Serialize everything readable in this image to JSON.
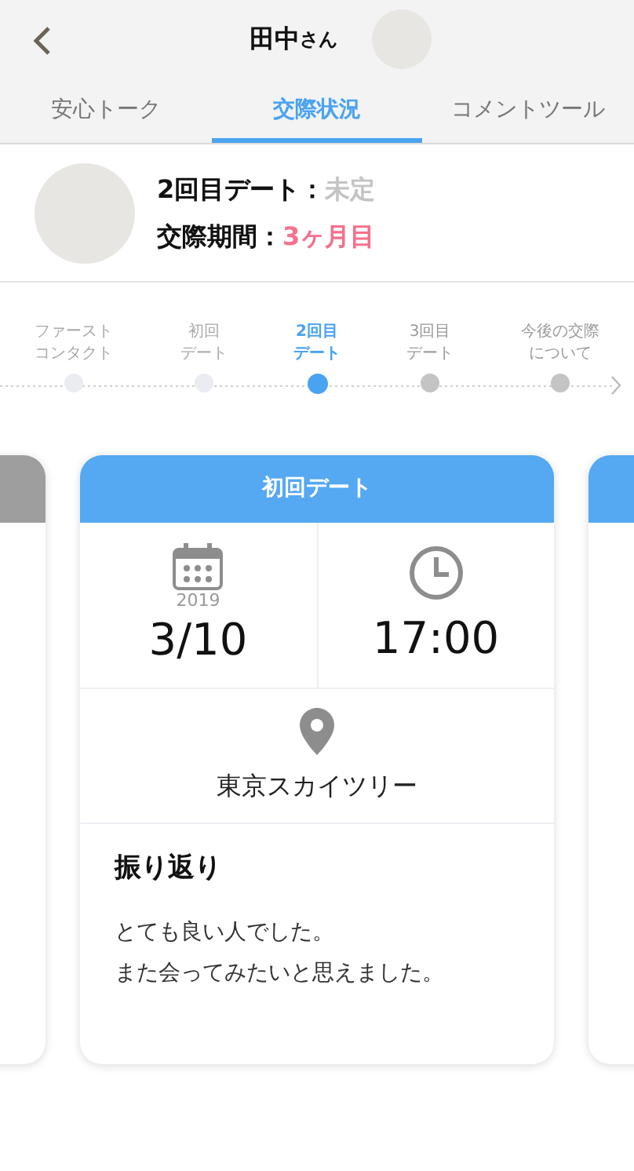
{
  "header": {
    "name": "田中",
    "honorific": "さん"
  },
  "tabs": [
    {
      "label": "安心トーク",
      "selected": false
    },
    {
      "label": "交際状況",
      "selected": true
    },
    {
      "label": "コメントツール",
      "selected": false
    }
  ],
  "profile": {
    "rows": [
      {
        "label": "2回目デート：",
        "value": "未定",
        "kind": "muted"
      },
      {
        "label": "交際期間：",
        "value": "3ヶ月目",
        "kind": "highlight"
      }
    ]
  },
  "steps": [
    {
      "lines": [
        "ファースト",
        "コンタクト"
      ],
      "kind": "done",
      "selected": false
    },
    {
      "lines": [
        "初回",
        "デート"
      ],
      "kind": "done",
      "selected": false
    },
    {
      "lines": [
        "2回目",
        "デート"
      ],
      "kind": "current",
      "selected": true
    },
    {
      "lines": [
        "3回目",
        "デート"
      ],
      "kind": "upcoming",
      "selected": false
    },
    {
      "lines": [
        "今後の交際",
        "について"
      ],
      "kind": "upcoming",
      "selected": false
    }
  ],
  "side_cards": [
    {
      "color": "#9e9e9e"
    },
    {
      "color": "#55a8f2"
    }
  ],
  "card": {
    "title": "初回デート",
    "year": "2019",
    "date": "3/10",
    "time": "17:00",
    "place": "東京スカイツリー",
    "review_title": "振り返り",
    "review_lines": [
      "とても良い人でした。",
      "また会ってみたいと思えました。"
    ]
  }
}
